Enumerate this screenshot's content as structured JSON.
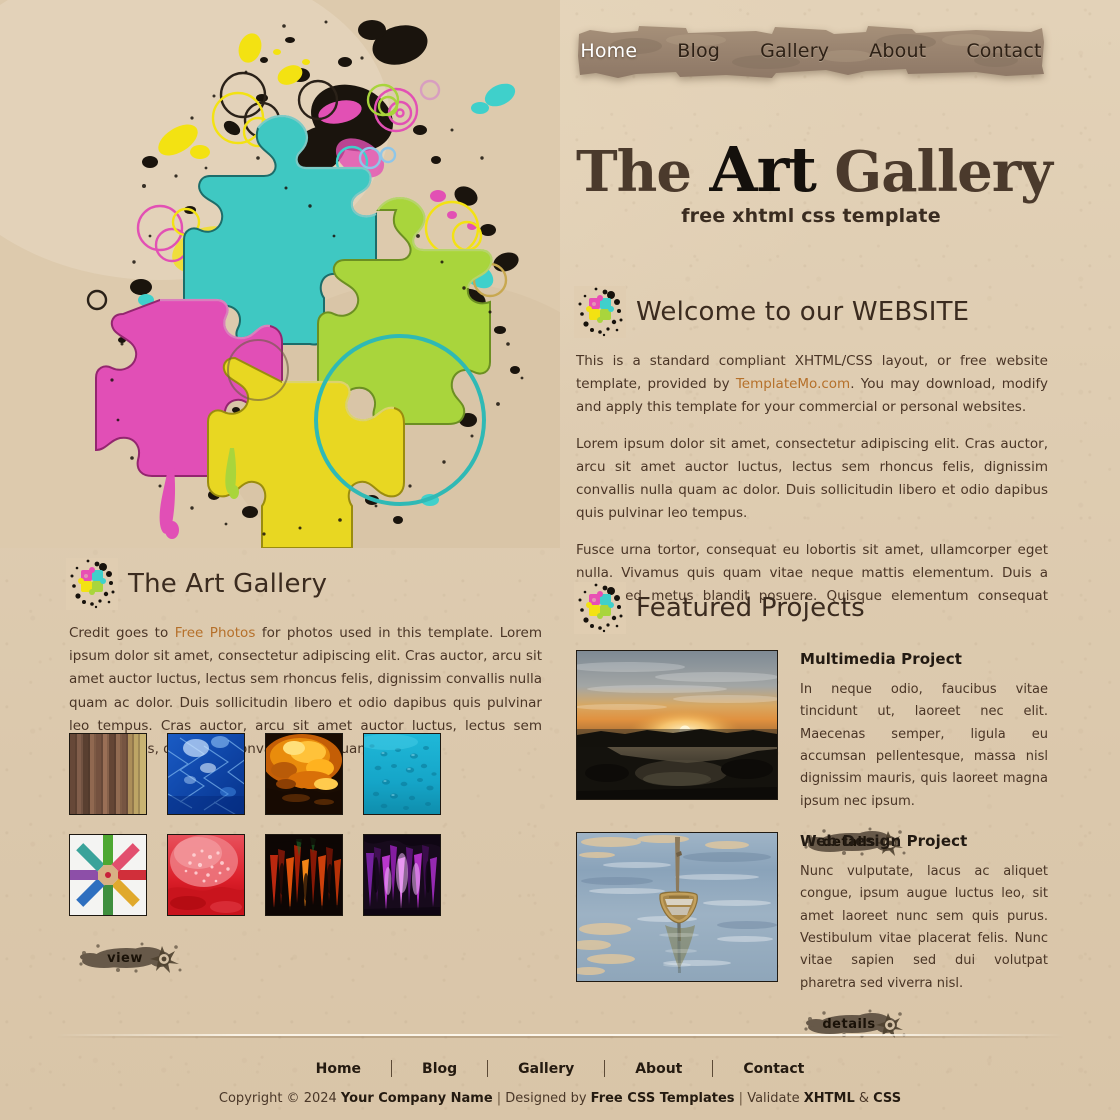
{
  "site": {
    "title_parts": {
      "the": "The ",
      "art": "Art",
      "gallery": " Gallery"
    },
    "title_plain": "The Art Gallery",
    "tagline": "free xhtml css template"
  },
  "nav": {
    "items": [
      {
        "label": "Home",
        "active": true
      },
      {
        "label": "Blog",
        "active": false
      },
      {
        "label": "Gallery",
        "active": false
      },
      {
        "label": "About",
        "active": false
      },
      {
        "label": "Contact",
        "active": false
      }
    ]
  },
  "welcome": {
    "heading": "Welcome to our WEBSITE",
    "icon": "puzzle-splatter-icon",
    "paragraph1_pre": "This is a standard compliant XHTML/CSS layout, or free website template, provided by ",
    "paragraph1_link": "TemplateMo.com",
    "paragraph1_post": ". You may download, modify and apply this template for your commercial or personal websites.",
    "paragraph2": "Lorem ipsum dolor sit amet, consectetur adipiscing elit. Cras auctor, arcu sit amet auctor luctus, lectus sem rhoncus felis, dignissim convallis nulla quam ac dolor. Duis sollicitudin libero et odio dapibus quis pulvinar leo tempus.",
    "paragraph3": "Fusce urna tortor, consequat eu lobortis sit amet, ullamcorper eget nulla. Vivamus quis quam vitae neque mattis elementum. Duis a nulla sed metus blandit posuere. Quisque elementum consequat felis."
  },
  "gallery": {
    "heading": "The Art Gallery",
    "icon": "puzzle-splatter-icon",
    "credit_pre": "Credit goes to ",
    "credit_link": "Free Photos",
    "credit_post": " for photos used in this template. Lorem ipsum dolor sit amet, consectetur adipiscing elit. Cras auctor, arcu sit amet auctor luctus, lectus sem rhoncus felis, dignissim convallis nulla quam ac dolor. Duis sollicitudin libero et odio dapibus quis pulvinar leo tempus. Cras auctor, arcu sit amet auctor luctus, lectus sem rhoncus felis, dignissim convallis nulla quam ac dolor.",
    "view_label": "view",
    "thumbnails": [
      {
        "name": "colored-pencils-rows-thumb",
        "alt": "rows of colored pencils"
      },
      {
        "name": "blue-water-net-thumb",
        "alt": "blue water with net pattern"
      },
      {
        "name": "orange-fire-glass-thumb",
        "alt": "orange fiery glass"
      },
      {
        "name": "cyan-bubbles-thumb",
        "alt": "cyan surface with bubbles"
      },
      {
        "name": "pencil-star-thumb",
        "alt": "colored pencils in a star"
      },
      {
        "name": "red-bubbles-thumb",
        "alt": "red liquid with bubbles"
      },
      {
        "name": "red-black-streaks-thumb",
        "alt": "red and black streaks"
      },
      {
        "name": "purple-streaks-thumb",
        "alt": "purple magenta streaks"
      }
    ]
  },
  "featured": {
    "heading": "Featured Projects",
    "icon": "puzzle-splatter-icon",
    "projects": [
      {
        "title": "Multimedia Project",
        "image_name": "sunset-over-water-image",
        "text": "In neque odio, faucibus vitae tincidunt ut, laoreet nec elit. Maecenas semper, ligula eu accumsan pellentesque, massa nisl dignissim mauris, quis laoreet magna ipsum nec ipsum.",
        "button_label": "details"
      },
      {
        "title": "Web Design Project",
        "image_name": "boat-on-water-image",
        "text": "Nunc vulputate, lacus ac aliquet congue, ipsum augue luctus leo, sit amet laoreet nunc sem quis purus. Vestibulum vitae placerat felis. Nunc vitae sapien sed dui volutpat pharetra sed viverra nisl.",
        "button_label": "details"
      }
    ]
  },
  "footer": {
    "nav": [
      "Home",
      "Blog",
      "Gallery",
      "About",
      "Contact"
    ],
    "copyright_prefix": "Copyright © 2024 ",
    "company": "Your Company Name",
    "sep1": " | ",
    "designed_prefix": "Designed by ",
    "designer": "Free CSS Templates",
    "sep2": " | ",
    "validate_prefix": "Validate ",
    "validate_xhtml": "XHTML",
    "validate_amp": " & ",
    "validate_css": "CSS"
  },
  "theme": {
    "page_bg": "#dcc9ae",
    "nav_paper": "#9b8570",
    "accent_link": "#b5702a",
    "heading": "#3b2b1f",
    "body_text": "#4a3526"
  }
}
